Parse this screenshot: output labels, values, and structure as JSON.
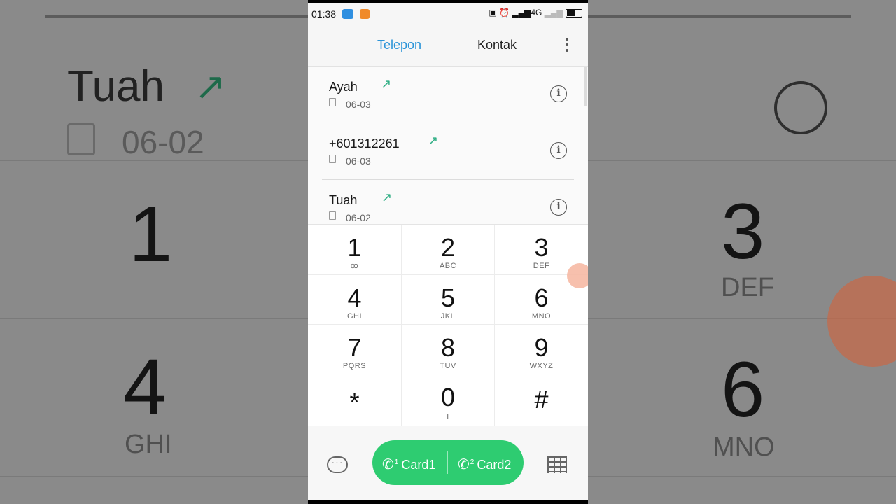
{
  "status_bar": {
    "time": "01:38",
    "network": "4G",
    "icons": [
      "message-icon",
      "app-icon",
      "cast-icon",
      "alarm-icon",
      "signal-icon",
      "battery-icon"
    ]
  },
  "tabs": {
    "phone": "Telepon",
    "contacts": "Kontak"
  },
  "recent_calls": [
    {
      "name": "Ayah",
      "date": "06-03",
      "type": "outgoing"
    },
    {
      "name": "+601312261",
      "date": "06-03",
      "type": "outgoing"
    },
    {
      "name": "Tuah",
      "date": "06-02",
      "type": "outgoing"
    }
  ],
  "dialpad": [
    {
      "digit": "1",
      "letters": "ꝏ"
    },
    {
      "digit": "2",
      "letters": "ABC"
    },
    {
      "digit": "3",
      "letters": "DEF"
    },
    {
      "digit": "4",
      "letters": "GHI"
    },
    {
      "digit": "5",
      "letters": "JKL"
    },
    {
      "digit": "6",
      "letters": "MNO"
    },
    {
      "digit": "7",
      "letters": "PQRS"
    },
    {
      "digit": "8",
      "letters": "TUV"
    },
    {
      "digit": "9",
      "letters": "WXYZ"
    },
    {
      "digit": "*",
      "letters": ""
    },
    {
      "digit": "0",
      "letters": "+"
    },
    {
      "digit": "#",
      "letters": ""
    }
  ],
  "call_buttons": {
    "card1": "Card1",
    "card1_index": "1",
    "card2": "Card2",
    "card2_index": "2"
  },
  "background_overlay": {
    "name": "Tuah",
    "date": "06-02",
    "digits": [
      "1",
      "3",
      "4",
      "6"
    ],
    "letters": [
      "DEF",
      "GHI",
      "MNO"
    ]
  },
  "colors": {
    "accent": "#2b94d8",
    "call_green": "#2ecc71",
    "outgoing_arrow": "#2fae84"
  }
}
